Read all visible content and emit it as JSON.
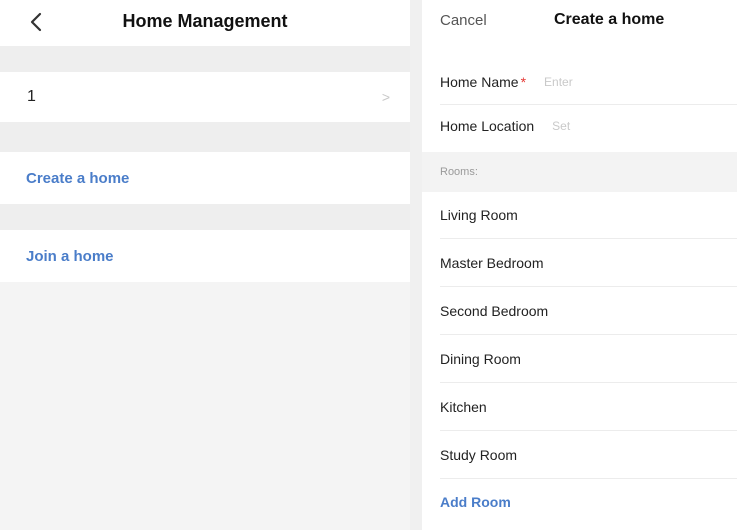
{
  "left_screen": {
    "title": "Home Management",
    "home_item": {
      "name": "1",
      "chevron": ">"
    },
    "create_home_label": "Create a home",
    "join_home_label": "Join a home",
    "accent_color": "#4a7dc9"
  },
  "right_screen": {
    "cancel_label": "Cancel",
    "title": "Create a home",
    "home_name_label": "Home Name",
    "required_mark": "*",
    "home_name_placeholder": "Enter",
    "home_location_label": "Home Location",
    "home_location_placeholder": "Set",
    "rooms_header": "Rooms:",
    "rooms": [
      "Living Room",
      "Master Bedroom",
      "Second Bedroom",
      "Dining Room",
      "Kitchen",
      "Study Room"
    ],
    "add_room_label": "Add Room",
    "required_color": "#e53935"
  }
}
